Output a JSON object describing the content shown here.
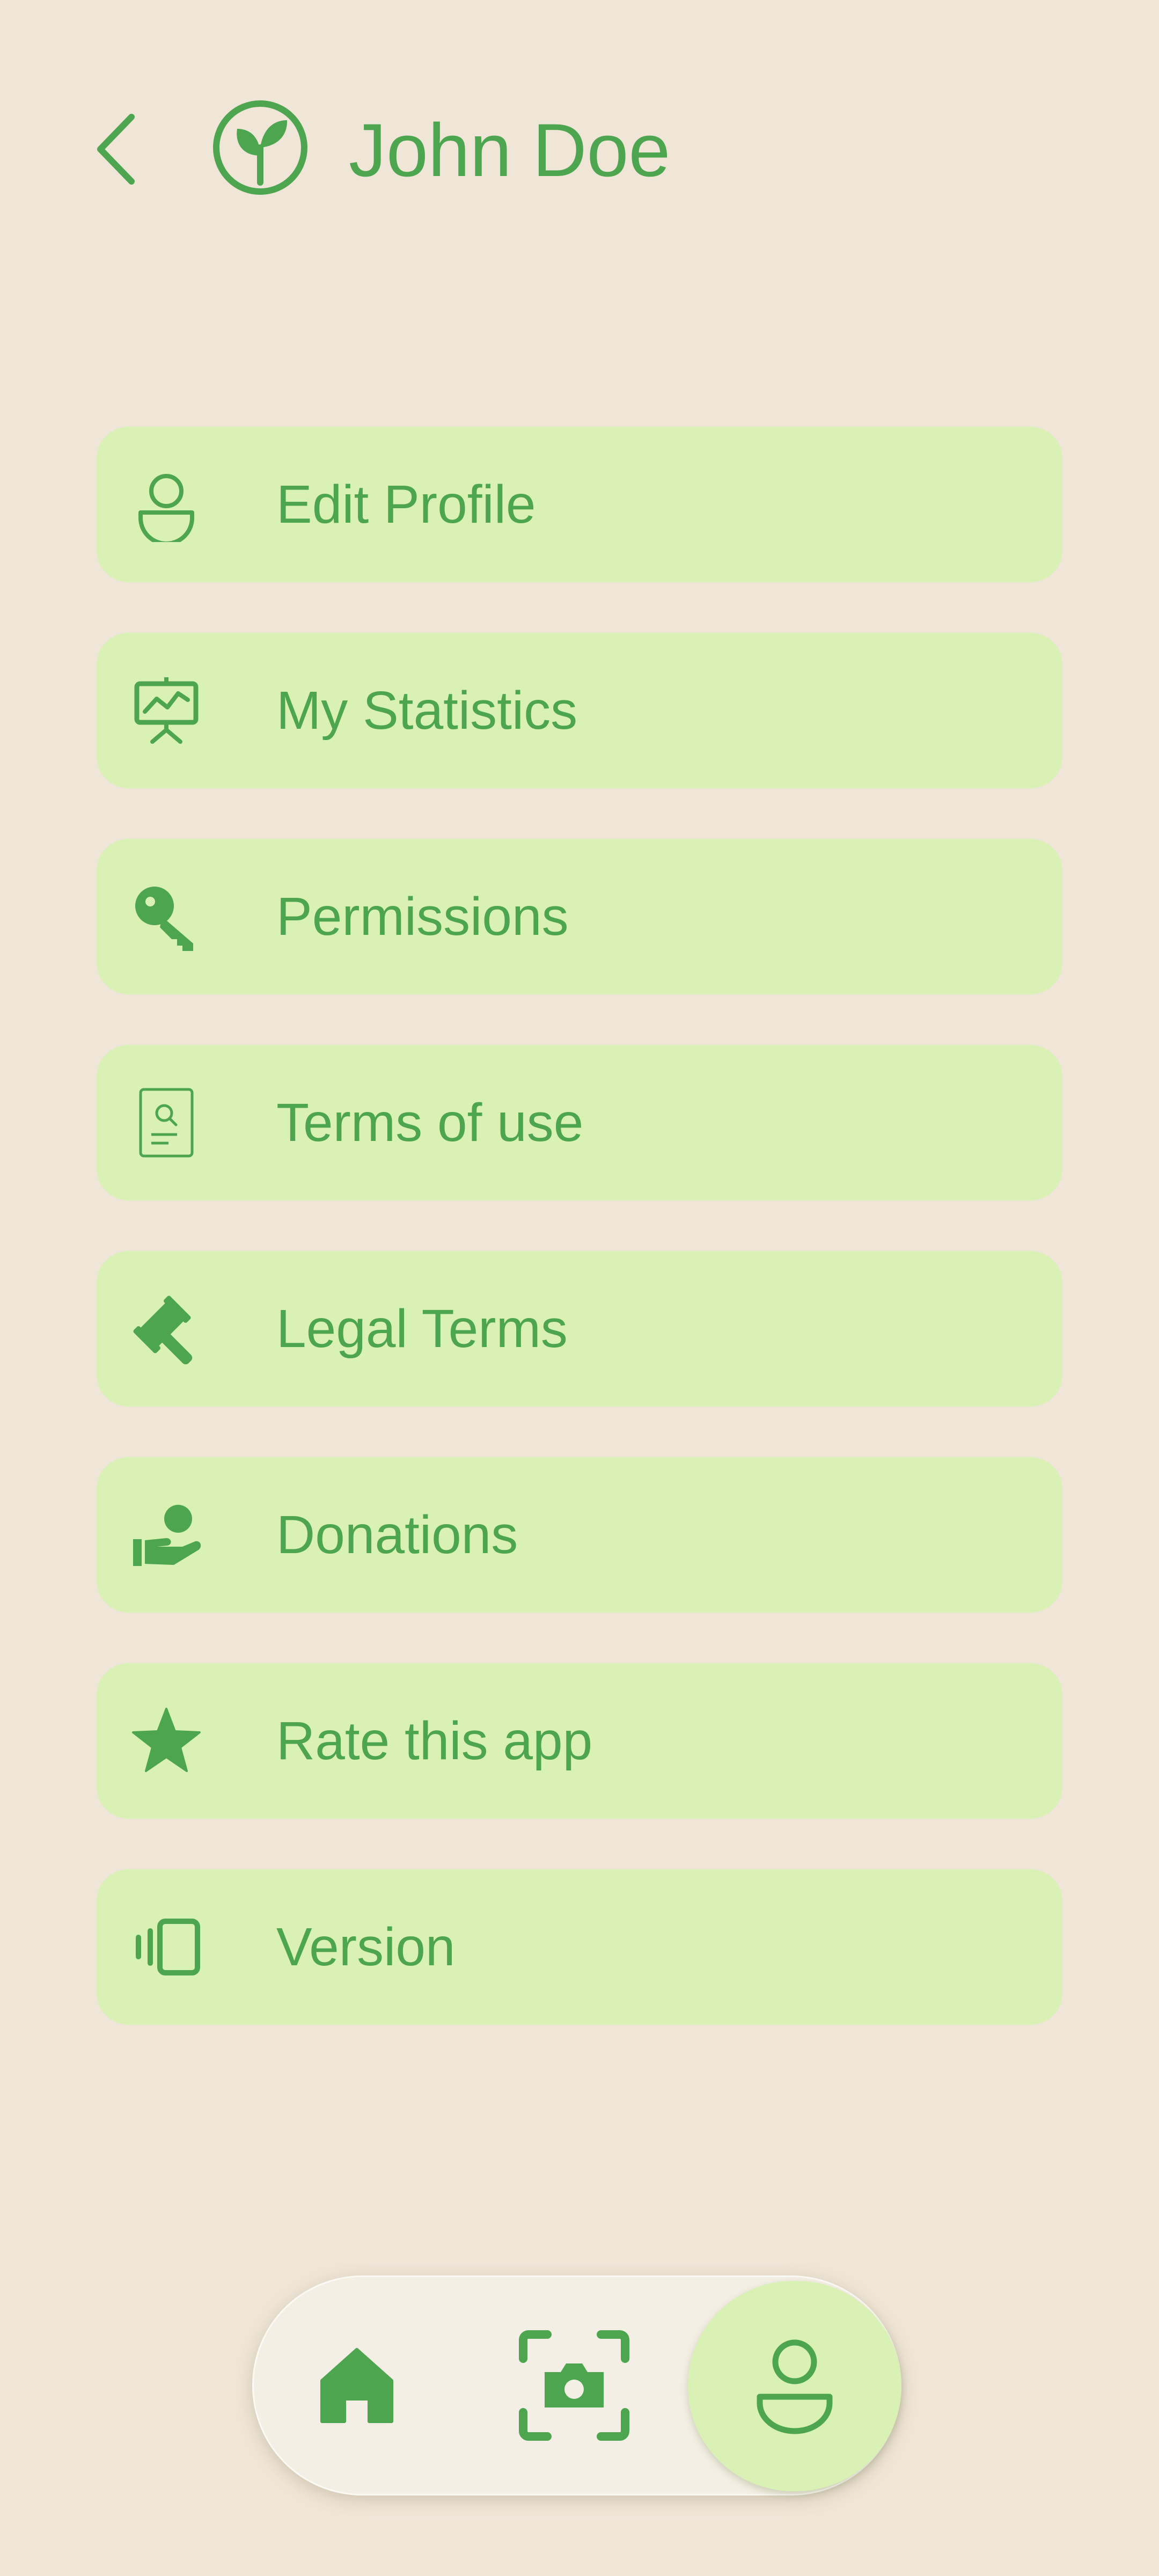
{
  "header": {
    "title": "John Doe",
    "back_icon": "chevron-left-icon",
    "logo_icon": "sprout-icon"
  },
  "menu": {
    "items": [
      {
        "label": "Edit Profile",
        "icon": "user-icon"
      },
      {
        "label": "My Statistics",
        "icon": "presentation-chart-icon"
      },
      {
        "label": "Permissions",
        "icon": "key-icon"
      },
      {
        "label": "Terms of use",
        "icon": "document-search-icon"
      },
      {
        "label": "Legal Terms",
        "icon": "gavel-icon"
      },
      {
        "label": "Donations",
        "icon": "hand-heart-donate-icon"
      },
      {
        "label": "Rate this app",
        "icon": "star-icon"
      },
      {
        "label": "Version",
        "icon": "vibrate-phone-icon"
      }
    ]
  },
  "bottom_nav": {
    "items": [
      {
        "icon": "home-icon",
        "active": false
      },
      {
        "icon": "camera-scan-icon",
        "active": false
      },
      {
        "icon": "user-icon",
        "active": true
      }
    ]
  },
  "colors": {
    "background": "#EFE6D8",
    "card": "#D9F1B4",
    "accent": "#4DA64F",
    "nav_background": "#F4EFE4"
  }
}
